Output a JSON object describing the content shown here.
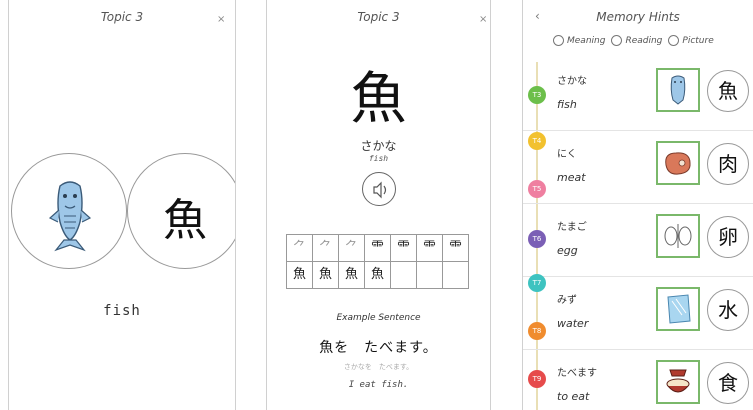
{
  "panel1": {
    "title": "Topic 3",
    "close": "×",
    "kanji": "魚",
    "word": "fish"
  },
  "panel2": {
    "title": "Topic 3",
    "close": "×",
    "kanji": "魚",
    "reading": "さかな",
    "meaning": "fish",
    "stroke_cells": [
      "⺈",
      "⺈",
      "⺈",
      "⻗",
      "⻗",
      "⻗",
      "⻗",
      "魚",
      "魚",
      "魚",
      "魚",
      "",
      "",
      ""
    ],
    "example_label": "Example Sentence",
    "example_sentence": "魚を　たべます。",
    "example_kana": "さかなを　たべます。",
    "example_translation": "I eat fish."
  },
  "panel3": {
    "back": "‹",
    "title": "Memory Hints",
    "options": [
      "Meaning",
      "Reading",
      "Picture"
    ],
    "items": [
      {
        "kana": "さかな",
        "english": "fish",
        "kanji": "魚"
      },
      {
        "kana": "にく",
        "english": "meat",
        "kanji": "肉"
      },
      {
        "kana": "たまご",
        "english": "egg",
        "kanji": "卵"
      },
      {
        "kana": "みず",
        "english": "water",
        "kanji": "水"
      },
      {
        "kana": "たべます",
        "english": "to eat",
        "kanji": "食"
      }
    ],
    "markers": [
      {
        "label": "T3",
        "color": "#6cbf4a"
      },
      {
        "label": "T4",
        "color": "#f2c12e"
      },
      {
        "label": "T5",
        "color": "#ef7fa0"
      },
      {
        "label": "T6",
        "color": "#7b5fb5"
      },
      {
        "label": "T7",
        "color": "#3ec3c0"
      },
      {
        "label": "T8",
        "color": "#f08c2e"
      },
      {
        "label": "T9",
        "color": "#e64b4b"
      }
    ]
  }
}
